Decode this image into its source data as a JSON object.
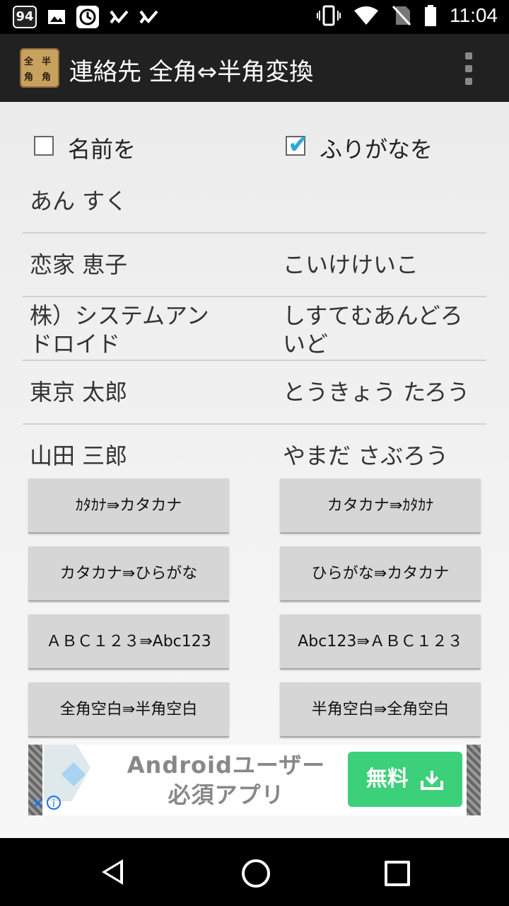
{
  "status_bar": {
    "badge": "94",
    "time": "11:04",
    "icons": [
      "image-icon",
      "history-icon",
      "task-check-icon",
      "task-check-icon",
      "vibrate-icon",
      "wifi-icon",
      "no-sim-icon",
      "battery-icon"
    ]
  },
  "app_bar": {
    "icon_glyphs": [
      "全",
      "半",
      "角",
      "角"
    ],
    "title": "連絡先 全角⇔半角変換"
  },
  "options": {
    "name_label": "名前を",
    "name_checked": false,
    "furigana_label": "ふりがなを",
    "furigana_checked": true
  },
  "contacts": [
    {
      "name": "あん すく",
      "furigana": ""
    },
    {
      "name": "恋家 恵子",
      "furigana": "こいけけいこ"
    },
    {
      "name": "株）システムアンドロイド",
      "furigana": "しすてむあんどろいど"
    },
    {
      "name": "東京 太郎",
      "furigana": "とうきょう たろう"
    },
    {
      "name": "山田 三郎",
      "furigana": "やまだ さぶろう"
    }
  ],
  "buttons": [
    {
      "left": "ｶﾀｶﾅ⇛カタカナ",
      "right": "カタカナ⇛ｶﾀｶﾅ"
    },
    {
      "left": "カタカナ⇛ひらがな",
      "right": "ひらがな⇛カタカナ"
    },
    {
      "left": "ＡＢＣ１２３⇛Abc123",
      "right": "Abc123⇛ＡＢＣ１２３"
    },
    {
      "left": "全角空白⇛半角空白",
      "right": "半角空白⇛全角空白"
    }
  ],
  "ad": {
    "text_line1": "Androidユーザー",
    "text_line2": "必須アプリ",
    "cta": "無料"
  },
  "colors": {
    "accent": "#2ea7dc",
    "cta": "#3dd07a"
  }
}
